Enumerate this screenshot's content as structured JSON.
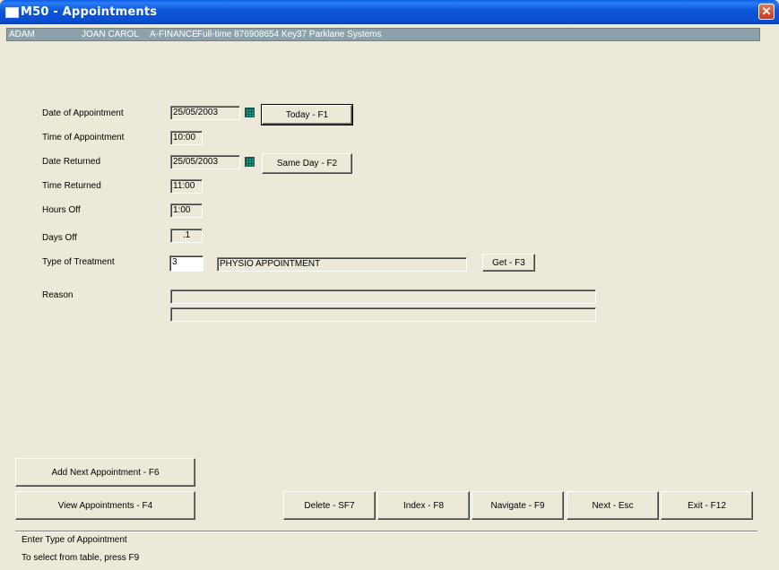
{
  "window": {
    "title": "M50 - Appointments",
    "close_symbol": "✕"
  },
  "infobar": {
    "surname": "ADAM",
    "forenames": "JOAN CAROL",
    "department": "A-FINANCE",
    "details": "Full-time 876908654 Key:",
    "company": "37 Parklane Systems"
  },
  "form": {
    "date_of_appointment": {
      "label": "Date of Appointment",
      "value": "25/05/2003"
    },
    "time_of_appointment": {
      "label": "Time of Appointment",
      "value": "10:00"
    },
    "date_returned": {
      "label": "Date Returned",
      "value": "25/05/2003"
    },
    "time_returned": {
      "label": "Time Returned",
      "value": "11:00"
    },
    "hours_off": {
      "label": "Hours Off",
      "value": "1:00"
    },
    "days_off": {
      "label": "Days Off",
      "value": ".1"
    },
    "type_of_treatment": {
      "label": "Type of Treatment",
      "code": "3",
      "description": "PHYSIO APPOINTMENT"
    },
    "reason": {
      "label": "Reason",
      "line1": "",
      "line2": ""
    }
  },
  "buttons": {
    "today": "Today - F1",
    "same_day": "Same Day - F2",
    "get": "Get - F3",
    "add_next": "Add Next Appointment - F6",
    "view": "View Appointments - F4",
    "delete": "Delete - SF7",
    "index": "Index - F8",
    "navigate": "Navigate - F9",
    "next": "Next - Esc",
    "exit": "Exit - F12"
  },
  "status": {
    "line1": "Enter Type of Appointment",
    "line2": "To select from table, press F9"
  }
}
